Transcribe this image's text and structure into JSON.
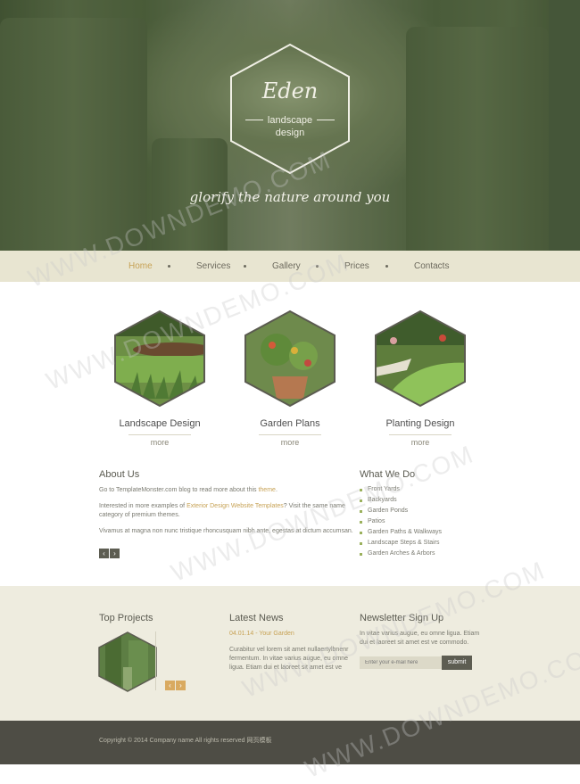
{
  "hero": {
    "logo_title": "Eden",
    "logo_subtitle": "landscape\ndesign",
    "tagline": "glorify the nature around you"
  },
  "nav": {
    "items": [
      {
        "label": "Home",
        "active": true
      },
      {
        "label": "Services",
        "active": false
      },
      {
        "label": "Gallery",
        "active": false
      },
      {
        "label": "Prices",
        "active": false
      },
      {
        "label": "Contacts",
        "active": false
      }
    ]
  },
  "features": [
    {
      "label": "Landscape Design",
      "more": "more"
    },
    {
      "label": "Garden Plans",
      "more": "more"
    },
    {
      "label": "Planting Design",
      "more": "more"
    }
  ],
  "about": {
    "heading": "About Us",
    "p1_prefix": "Go to TemplateMonster.com blog to read more about this ",
    "p1_link": "theme",
    "p1_suffix": ".",
    "p2_prefix": "Interested in more examples of ",
    "p2_link": "Exterior Design Website Templates",
    "p2_suffix": "? Visit the same name category of premium themes.",
    "p3": "Vivamus at magna non nunc tristique rhoncusquam nibh ante, egestas at dictum accumsan."
  },
  "what_we_do": {
    "heading": "What We Do",
    "items": [
      "Front Yards",
      "Backyards",
      "Garden Ponds",
      "Patios",
      "Garden Paths & Walkways",
      "Landscape Steps & Stairs",
      "Garden Arches & Arbors"
    ]
  },
  "top_projects": {
    "heading": "Top Projects"
  },
  "latest_news": {
    "heading": "Latest News",
    "meta": "04.01.14 - Your Garden",
    "text": "Curabitur vel lorem sit amet nullaertylbnenr fermentum. In vitae varius augue, eu omne ligua. Etiam dui et laoreet sit amet est ve"
  },
  "newsletter": {
    "heading": "Newsletter Sign Up",
    "text": "In vitae varius augue, eu omne ligua. Etiam dui et laoreet sit amet est ve commodo.",
    "placeholder": "Enter your e-mail here",
    "submit": "submit"
  },
  "footer": {
    "copyright": "Copyright © 2014 Company name All rights reserved 网页模板"
  },
  "watermark": "WWW.DOWNDEMO.COM",
  "colors": {
    "accent": "#c7a255",
    "nav_bg": "#e8e5d1",
    "footer_dark": "#4e4d45",
    "bullet": "#9bb15d"
  }
}
